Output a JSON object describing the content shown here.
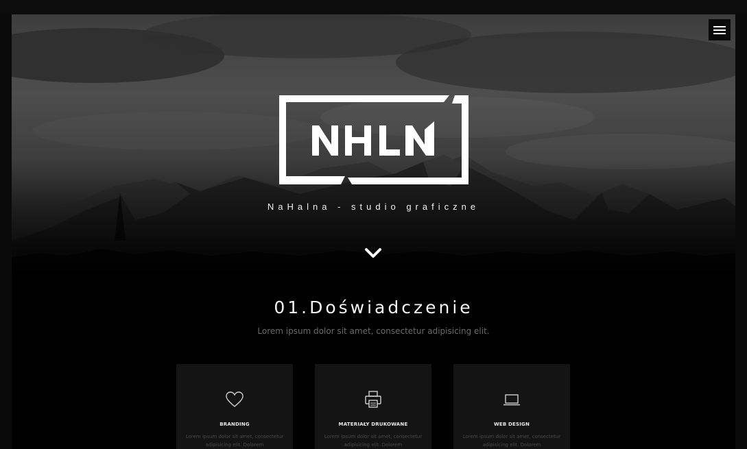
{
  "hero": {
    "logo_text": "NHLN",
    "tagline": "NaHalna - studio graficzne"
  },
  "menu": {
    "icon": "hamburger-menu-icon"
  },
  "scroll": {
    "icon": "chevron-down-icon"
  },
  "section": {
    "title": "01.Doświadczenie",
    "subtitle": "Lorem ipsum dolor sit amet, consectetur adipisicing elit."
  },
  "cards": [
    {
      "icon": "heart-icon",
      "title": "BRANDING",
      "text": "Lorem ipsum dolor sit amet, consectetur adipisicing elit. Dolorem"
    },
    {
      "icon": "printer-icon",
      "title": "MATERIAŁY DRUKOWANE",
      "text": "Lorem ipsum dolor sit amet, consectetur adipisicing elit. Dolorem"
    },
    {
      "icon": "laptop-icon",
      "title": "WEB DESIGN",
      "text": "Lorem ipsum dolor sit amet, consectetur adipisicing elit. Dolorem"
    }
  ],
  "colors": {
    "background": "#000000",
    "card_background": "#141414",
    "text_primary": "#f4f4f4",
    "text_muted": "#6a6a6a"
  }
}
